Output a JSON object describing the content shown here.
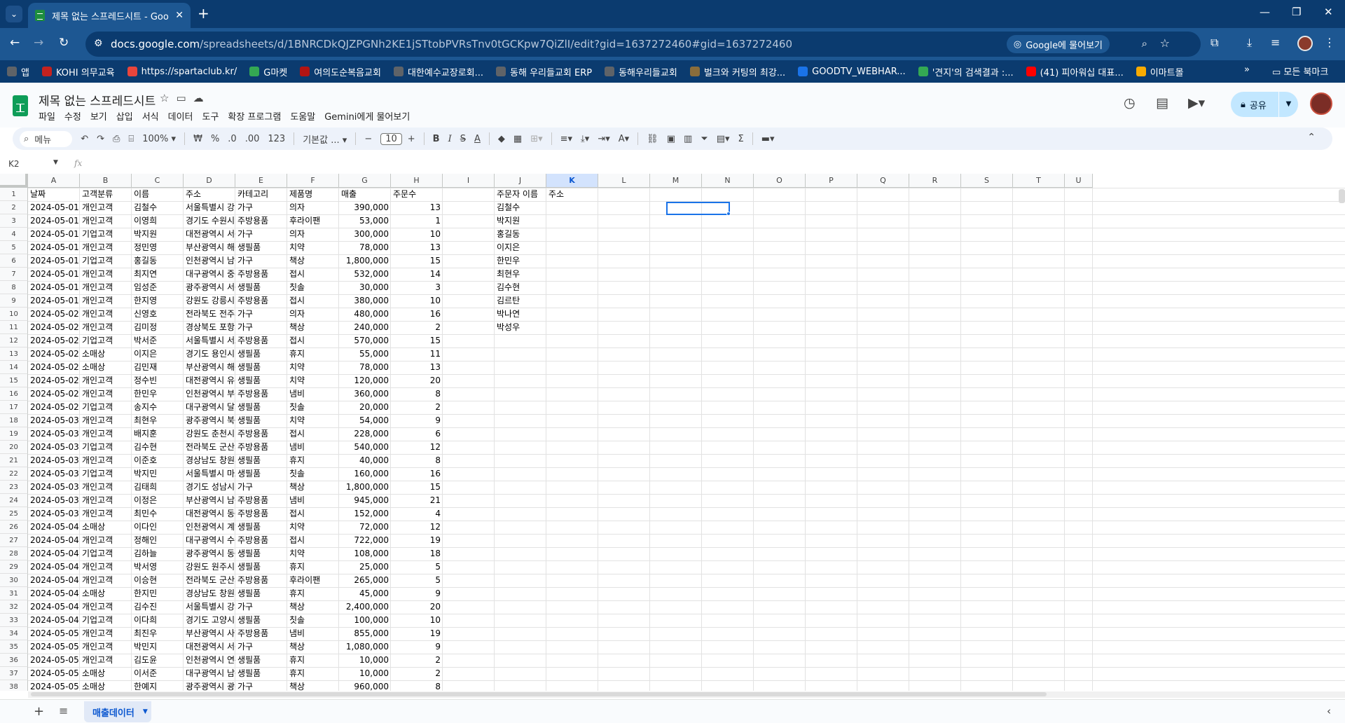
{
  "browser": {
    "tab_title": "제목 없는 스프레드시트 - Goo",
    "url_host": "docs.google.com",
    "url_path": "/spreadsheets/d/1BNRCDkQJZPGNh2KE1jSTtobPVRsTnv0tGCKpw7QiZlI/edit?gid=1637272460#gid=1637272460",
    "gemini_chip": "Google에 물어보기"
  },
  "bookmarks": [
    {
      "label": "앱",
      "color": "#5f6368"
    },
    {
      "label": "KOHI 의무교육",
      "color": "#c5221f"
    },
    {
      "label": "https://spartaclub.kr/",
      "color": "#e8453c"
    },
    {
      "label": "G마켓",
      "color": "#34a853"
    },
    {
      "label": "여의도순복음교회",
      "color": "#b31412"
    },
    {
      "label": "대한예수교장로회...",
      "color": "#5f6368"
    },
    {
      "label": "동해 우리들교회 ERP",
      "color": "#5f6368"
    },
    {
      "label": "동해우리들교회",
      "color": "#5f6368"
    },
    {
      "label": "벌크와 커팅의 최강...",
      "color": "#8a6d3b"
    },
    {
      "label": "GOODTV_WEBHAR...",
      "color": "#1a73e8"
    },
    {
      "label": "'견지'의 검색결과 :...",
      "color": "#34a853"
    },
    {
      "label": "(41) 피아워십 대표...",
      "color": "#ff0000"
    },
    {
      "label": "이마트몰",
      "color": "#f9ab00"
    }
  ],
  "all_bookmarks": "모든 북마크",
  "doc": {
    "title": "제목 없는 스프레드시트",
    "menus": [
      "파일",
      "수정",
      "보기",
      "삽입",
      "서식",
      "데이터",
      "도구",
      "확장 프로그램",
      "도움말",
      "Gemini에게 물어보기"
    ],
    "share_label": "공유"
  },
  "toolbar": {
    "search": "메뉴",
    "zoom": "100%",
    "currency": "₩",
    "percent": "%",
    "dec_less": ".0",
    "dec_more": ".00",
    "format_123": "123",
    "font": "기본값 ...",
    "font_size": "10"
  },
  "formula_bar": {
    "name_box": "K2",
    "fx": "fx"
  },
  "columns": [
    "A",
    "B",
    "C",
    "D",
    "E",
    "F",
    "G",
    "H",
    "I",
    "J",
    "K",
    "L",
    "M",
    "N",
    "O",
    "P",
    "Q",
    "R",
    "S",
    "T",
    "U"
  ],
  "selected_column": "K",
  "header_row": [
    "날짜",
    "고객분류",
    "이름",
    "주소",
    "카테고리",
    "제품명",
    "매출",
    "주문수",
    "",
    "주문자 이름",
    "주소"
  ],
  "rows": [
    [
      "2024-05-01",
      "개인고객",
      "김철수",
      "서울특별시 강남구",
      "가구",
      "의자",
      "390,000",
      "13",
      "김철수"
    ],
    [
      "2024-05-01",
      "개인고객",
      "이영희",
      "경기도 수원시 팔달",
      "주방용품",
      "후라이팬",
      "53,000",
      "1",
      "박지원"
    ],
    [
      "2024-05-01",
      "기업고객",
      "박지원",
      "대전광역시 서구 둔",
      "가구",
      "의자",
      "300,000",
      "10",
      "홍길동"
    ],
    [
      "2024-05-01",
      "개인고객",
      "정민영",
      "부산광역시 해운대",
      "생필품",
      "치약",
      "78,000",
      "13",
      "이지은"
    ],
    [
      "2024-05-01",
      "기업고객",
      "홍길동",
      "인천광역시 남동구",
      "가구",
      "책상",
      "1,800,000",
      "15",
      "한민우"
    ],
    [
      "2024-05-01",
      "개인고객",
      "최지연",
      "대구광역시 중구 동",
      "주방용품",
      "접시",
      "532,000",
      "14",
      "최현우"
    ],
    [
      "2024-05-01",
      "개인고객",
      "임성준",
      "광주광역시 서구 치",
      "생필품",
      "칫솔",
      "30,000",
      "3",
      "김수현"
    ],
    [
      "2024-05-01",
      "개인고객",
      "한지영",
      "강원도 강릉시 난곡",
      "주방용품",
      "접시",
      "380,000",
      "10",
      "김르탄"
    ],
    [
      "2024-05-02",
      "개인고객",
      "신영호",
      "전라북도 전주시 완",
      "가구",
      "의자",
      "480,000",
      "16",
      "박나연"
    ],
    [
      "2024-05-02",
      "개인고객",
      "김미정",
      "경상북도 포항시 남",
      "가구",
      "책상",
      "240,000",
      "2",
      "박성우"
    ],
    [
      "2024-05-02",
      "기업고객",
      "박서준",
      "서울특별시 서초구",
      "주방용품",
      "접시",
      "570,000",
      "15",
      ""
    ],
    [
      "2024-05-02",
      "소매상",
      "이지은",
      "경기도 용인시 수지",
      "생필품",
      "휴지",
      "55,000",
      "11",
      ""
    ],
    [
      "2024-05-02",
      "소매상",
      "김민재",
      "부산광역시 해운대",
      "생필품",
      "치약",
      "78,000",
      "13",
      ""
    ],
    [
      "2024-05-02",
      "개인고객",
      "정수빈",
      "대전광역시 유성구",
      "생필품",
      "치약",
      "120,000",
      "20",
      ""
    ],
    [
      "2024-05-02",
      "개인고객",
      "한민우",
      "인천광역시 부평구",
      "주방용품",
      "냄비",
      "360,000",
      "8",
      ""
    ],
    [
      "2024-05-02",
      "기업고객",
      "송지수",
      "대구광역시 달서구",
      "생필품",
      "칫솔",
      "20,000",
      "2",
      ""
    ],
    [
      "2024-05-03",
      "개인고객",
      "최현우",
      "광주광역시 북구 운",
      "생필품",
      "치약",
      "54,000",
      "9",
      ""
    ],
    [
      "2024-05-03",
      "개인고객",
      "배지훈",
      "강원도 춘천시 후평",
      "주방용품",
      "접시",
      "228,000",
      "6",
      ""
    ],
    [
      "2024-05-03",
      "기업고객",
      "김수현",
      "전라북도 군산시 나",
      "주방용품",
      "냄비",
      "540,000",
      "12",
      ""
    ],
    [
      "2024-05-03",
      "개인고객",
      "이준호",
      "경상남도 창원시 성",
      "생필품",
      "휴지",
      "40,000",
      "8",
      ""
    ],
    [
      "2024-05-03",
      "기업고객",
      "박지민",
      "서울특별시 마포구",
      "생필품",
      "칫솔",
      "160,000",
      "16",
      ""
    ],
    [
      "2024-05-03",
      "개인고객",
      "김태희",
      "경기도 성남시 분당",
      "가구",
      "책상",
      "1,800,000",
      "15",
      ""
    ],
    [
      "2024-05-03",
      "개인고객",
      "이정은",
      "부산광역시 남구 대",
      "주방용품",
      "냄비",
      "945,000",
      "21",
      ""
    ],
    [
      "2024-05-03",
      "개인고객",
      "최민수",
      "대전광역시 동구 중",
      "주방용품",
      "접시",
      "152,000",
      "4",
      ""
    ],
    [
      "2024-05-04",
      "소매상",
      "이다인",
      "인천광역시 계양구",
      "생필품",
      "치약",
      "72,000",
      "12",
      ""
    ],
    [
      "2024-05-04",
      "개인고객",
      "정해인",
      "대구광역시 수성구",
      "주방용품",
      "접시",
      "722,000",
      "19",
      ""
    ],
    [
      "2024-05-04",
      "기업고객",
      "김하늘",
      "광주광역시 동구 서",
      "생필품",
      "치약",
      "108,000",
      "18",
      ""
    ],
    [
      "2024-05-04",
      "개인고객",
      "박서영",
      "강원도 원주시 단구",
      "생필품",
      "휴지",
      "25,000",
      "5",
      ""
    ],
    [
      "2024-05-04",
      "개인고객",
      "이승현",
      "전라북도 군산시 조",
      "주방용품",
      "후라이팬",
      "265,000",
      "5",
      ""
    ],
    [
      "2024-05-04",
      "소매상",
      "한지민",
      "경상남도 창원시 의",
      "생필품",
      "휴지",
      "45,000",
      "9",
      ""
    ],
    [
      "2024-05-04",
      "개인고객",
      "김수진",
      "서울특별시 강서구",
      "가구",
      "책상",
      "2,400,000",
      "20",
      ""
    ],
    [
      "2024-05-04",
      "기업고객",
      "이다희",
      "경기도 고양시 일산",
      "생필품",
      "칫솔",
      "100,000",
      "10",
      ""
    ],
    [
      "2024-05-05",
      "개인고객",
      "최진우",
      "부산광역시 사하구",
      "주방용품",
      "냄비",
      "855,000",
      "19",
      ""
    ],
    [
      "2024-05-05",
      "개인고객",
      "박민지",
      "대전광역시 서구 갈",
      "가구",
      "책상",
      "1,080,000",
      "9",
      ""
    ],
    [
      "2024-05-05",
      "개인고객",
      "김도윤",
      "인천광역시 연수구",
      "생필품",
      "휴지",
      "10,000",
      "2",
      ""
    ],
    [
      "2024-05-05",
      "소매상",
      "이서준",
      "대구광역시 남구 대",
      "생필품",
      "휴지",
      "10,000",
      "2",
      ""
    ],
    [
      "2024-05-05",
      "소매상",
      "한예지",
      "광주광역시 광산구",
      "가구",
      "책상",
      "960,000",
      "8",
      ""
    ]
  ],
  "sheet_tab": "매출데이터"
}
